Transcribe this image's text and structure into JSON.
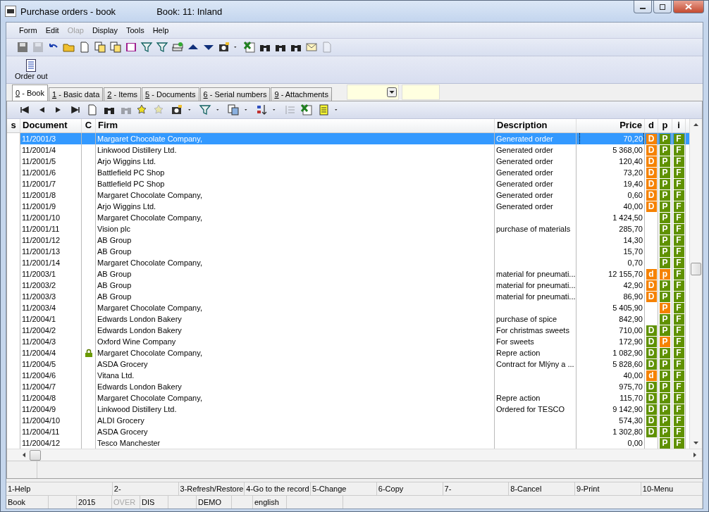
{
  "window": {
    "title": "Purchase orders - book",
    "subtitle": "Book: 11: Inland"
  },
  "menu": [
    {
      "label": "Form",
      "disabled": false
    },
    {
      "label": "Edit",
      "disabled": false
    },
    {
      "label": "Olap",
      "disabled": true
    },
    {
      "label": "Display",
      "disabled": false
    },
    {
      "label": "Tools",
      "disabled": false
    },
    {
      "label": "Help",
      "disabled": false
    }
  ],
  "action_button": {
    "label": "Order out"
  },
  "tabs": [
    {
      "key": "0",
      "label": "- Book",
      "selected": true
    },
    {
      "key": "1",
      "label": "- Basic data",
      "selected": false
    },
    {
      "key": "2",
      "label": "- Items",
      "selected": false
    },
    {
      "key": "5",
      "label": "- Documents",
      "selected": false
    },
    {
      "key": "6",
      "label": "- Serial numbers",
      "selected": false
    },
    {
      "key": "9",
      "label": "- Attachments",
      "selected": false
    }
  ],
  "table": {
    "columns": [
      "s",
      "Document",
      "C",
      "Firm",
      "Description",
      "Price",
      "d",
      "p",
      "i"
    ],
    "rows": [
      {
        "document": "11/2001/3",
        "locked": false,
        "firm": "Margaret Chocolate Company,",
        "description": "Generated order",
        "price": "70,20",
        "d": {
          "text": "D",
          "color": "#f58200"
        },
        "p": {
          "text": "P",
          "color": "#5f9100"
        },
        "i": {
          "text": "F",
          "color": "#5f9100"
        },
        "selected": true
      },
      {
        "document": "11/2001/4",
        "locked": false,
        "firm": "Linkwood Distillery Ltd.",
        "description": "Generated order",
        "price": "5 368,00",
        "d": {
          "text": "D",
          "color": "#f58200"
        },
        "p": {
          "text": "P",
          "color": "#5f9100"
        },
        "i": {
          "text": "F",
          "color": "#5f9100"
        },
        "selected": false
      },
      {
        "document": "11/2001/5",
        "locked": false,
        "firm": "Arjo Wiggins Ltd.",
        "description": "Generated order",
        "price": "120,40",
        "d": {
          "text": "D",
          "color": "#f58200"
        },
        "p": {
          "text": "P",
          "color": "#5f9100"
        },
        "i": {
          "text": "F",
          "color": "#5f9100"
        },
        "selected": false
      },
      {
        "document": "11/2001/6",
        "locked": false,
        "firm": "Battlefield PC Shop",
        "description": "Generated order",
        "price": "73,20",
        "d": {
          "text": "D",
          "color": "#f58200"
        },
        "p": {
          "text": "P",
          "color": "#5f9100"
        },
        "i": {
          "text": "F",
          "color": "#5f9100"
        },
        "selected": false
      },
      {
        "document": "11/2001/7",
        "locked": false,
        "firm": "Battlefield PC Shop",
        "description": "Generated order",
        "price": "19,40",
        "d": {
          "text": "D",
          "color": "#f58200"
        },
        "p": {
          "text": "P",
          "color": "#5f9100"
        },
        "i": {
          "text": "F",
          "color": "#5f9100"
        },
        "selected": false
      },
      {
        "document": "11/2001/8",
        "locked": false,
        "firm": "Margaret Chocolate Company,",
        "description": "Generated order",
        "price": "0,60",
        "d": {
          "text": "D",
          "color": "#f58200"
        },
        "p": {
          "text": "P",
          "color": "#5f9100"
        },
        "i": {
          "text": "F",
          "color": "#5f9100"
        },
        "selected": false
      },
      {
        "document": "11/2001/9",
        "locked": false,
        "firm": "Arjo Wiggins Ltd.",
        "description": "Generated order",
        "price": "40,00",
        "d": {
          "text": "D",
          "color": "#f58200"
        },
        "p": {
          "text": "P",
          "color": "#5f9100"
        },
        "i": {
          "text": "F",
          "color": "#5f9100"
        },
        "selected": false
      },
      {
        "document": "11/2001/10",
        "locked": false,
        "firm": "Margaret Chocolate Company,",
        "price": "1 424,50",
        "p": {
          "text": "P",
          "color": "#5f9100"
        },
        "i": {
          "text": "F",
          "color": "#5f9100"
        },
        "selected": false
      },
      {
        "document": "11/2001/11",
        "locked": false,
        "firm": "Vision plc",
        "description": "purchase of materials",
        "price": "285,70",
        "p": {
          "text": "P",
          "color": "#5f9100"
        },
        "i": {
          "text": "F",
          "color": "#5f9100"
        },
        "selected": false
      },
      {
        "document": "11/2001/12",
        "locked": false,
        "firm": "AB Group",
        "price": "14,30",
        "p": {
          "text": "P",
          "color": "#5f9100"
        },
        "i": {
          "text": "F",
          "color": "#5f9100"
        },
        "selected": false
      },
      {
        "document": "11/2001/13",
        "locked": false,
        "firm": "AB Group",
        "price": "15,70",
        "p": {
          "text": "P",
          "color": "#5f9100"
        },
        "i": {
          "text": "F",
          "color": "#5f9100"
        },
        "selected": false
      },
      {
        "document": "11/2001/14",
        "locked": false,
        "firm": "Margaret Chocolate Company,",
        "price": "0,70",
        "p": {
          "text": "P",
          "color": "#5f9100"
        },
        "i": {
          "text": "F",
          "color": "#5f9100"
        },
        "selected": false
      },
      {
        "document": "11/2003/1",
        "locked": false,
        "firm": "AB Group",
        "description": "material for pneumati...",
        "price": "12 155,70",
        "d": {
          "text": "d",
          "color": "#f58200"
        },
        "p": {
          "text": "p",
          "color": "#f58200"
        },
        "i": {
          "text": "F",
          "color": "#5f9100"
        },
        "selected": false
      },
      {
        "document": "11/2003/2",
        "locked": false,
        "firm": "AB Group",
        "description": "material for pneumati...",
        "price": "42,90",
        "d": {
          "text": "D",
          "color": "#f58200"
        },
        "p": {
          "text": "P",
          "color": "#5f9100"
        },
        "i": {
          "text": "F",
          "color": "#5f9100"
        },
        "selected": false
      },
      {
        "document": "11/2003/3",
        "locked": false,
        "firm": "AB Group",
        "description": "material for pneumati...",
        "price": "86,90",
        "d": {
          "text": "D",
          "color": "#f58200"
        },
        "p": {
          "text": "P",
          "color": "#5f9100"
        },
        "i": {
          "text": "F",
          "color": "#5f9100"
        },
        "selected": false
      },
      {
        "document": "11/2003/4",
        "locked": false,
        "firm": "Margaret Chocolate Company,",
        "price": "5 405,90",
        "p": {
          "text": "P",
          "color": "#f58200"
        },
        "i": {
          "text": "F",
          "color": "#5f9100"
        },
        "selected": false
      },
      {
        "document": "11/2004/1",
        "locked": false,
        "firm": "Edwards London Bakery",
        "description": "purchase of spice",
        "price": "842,90",
        "p": {
          "text": "P",
          "color": "#5f9100"
        },
        "i": {
          "text": "F",
          "color": "#5f9100"
        },
        "selected": false
      },
      {
        "document": "11/2004/2",
        "locked": false,
        "firm": "Edwards London Bakery",
        "description": "For christmas sweets",
        "price": "710,00",
        "d": {
          "text": "D",
          "color": "#5f9100"
        },
        "p": {
          "text": "P",
          "color": "#5f9100"
        },
        "i": {
          "text": "F",
          "color": "#5f9100"
        },
        "selected": false
      },
      {
        "document": "11/2004/3",
        "locked": false,
        "firm": "Oxford Wine Company",
        "description": "For sweets",
        "price": "172,90",
        "d": {
          "text": "D",
          "color": "#5f9100"
        },
        "p": {
          "text": "P",
          "color": "#f58200"
        },
        "i": {
          "text": "F",
          "color": "#5f9100"
        },
        "selected": false
      },
      {
        "document": "11/2004/4",
        "locked": true,
        "firm": "Margaret Chocolate Company,",
        "description": "Repre action",
        "price": "1 082,90",
        "d": {
          "text": "D",
          "color": "#5f9100"
        },
        "p": {
          "text": "P",
          "color": "#5f9100"
        },
        "i": {
          "text": "F",
          "color": "#5f9100"
        },
        "selected": false
      },
      {
        "document": "11/2004/5",
        "locked": false,
        "firm": "ASDA Grocery",
        "description": "Contract for Mlýny a ...",
        "price": "5 828,60",
        "d": {
          "text": "D",
          "color": "#5f9100"
        },
        "p": {
          "text": "P",
          "color": "#5f9100"
        },
        "i": {
          "text": "F",
          "color": "#5f9100"
        },
        "selected": false
      },
      {
        "document": "11/2004/6",
        "locked": false,
        "firm": "Vitana Ltd.",
        "price": "40,00",
        "d": {
          "text": "d",
          "color": "#f58200"
        },
        "p": {
          "text": "P",
          "color": "#5f9100"
        },
        "i": {
          "text": "F",
          "color": "#5f9100"
        },
        "selected": false
      },
      {
        "document": "11/2004/7",
        "locked": false,
        "firm": "Edwards London Bakery",
        "price": "975,70",
        "d": {
          "text": "D",
          "color": "#5f9100"
        },
        "p": {
          "text": "P",
          "color": "#5f9100"
        },
        "i": {
          "text": "F",
          "color": "#5f9100"
        },
        "selected": false
      },
      {
        "document": "11/2004/8",
        "locked": false,
        "firm": "Margaret Chocolate Company,",
        "description": "Repre action",
        "price": "115,70",
        "d": {
          "text": "D",
          "color": "#5f9100"
        },
        "p": {
          "text": "P",
          "color": "#5f9100"
        },
        "i": {
          "text": "F",
          "color": "#5f9100"
        },
        "selected": false
      },
      {
        "document": "11/2004/9",
        "locked": false,
        "firm": "Linkwood Distillery Ltd.",
        "description": "Ordered for TESCO",
        "price": "9 142,90",
        "d": {
          "text": "D",
          "color": "#5f9100"
        },
        "p": {
          "text": "P",
          "color": "#5f9100"
        },
        "i": {
          "text": "F",
          "color": "#5f9100"
        },
        "selected": false
      },
      {
        "document": "11/2004/10",
        "locked": false,
        "firm": "ALDI Grocery",
        "price": "574,30",
        "d": {
          "text": "D",
          "color": "#5f9100"
        },
        "p": {
          "text": "P",
          "color": "#5f9100"
        },
        "i": {
          "text": "F",
          "color": "#5f9100"
        },
        "selected": false
      },
      {
        "document": "11/2004/11",
        "locked": false,
        "firm": "ASDA Grocery",
        "price": "1 302,80",
        "d": {
          "text": "D",
          "color": "#5f9100"
        },
        "p": {
          "text": "P",
          "color": "#5f9100"
        },
        "i": {
          "text": "F",
          "color": "#5f9100"
        },
        "selected": false
      },
      {
        "document": "11/2004/12",
        "locked": false,
        "firm": "Tesco Manchester",
        "price": "0,00",
        "p": {
          "text": "P",
          "color": "#5f9100"
        },
        "i": {
          "text": "F",
          "color": "#5f9100"
        },
        "selected": false
      }
    ]
  },
  "function_keys": [
    "1-Help",
    "2-",
    "3-Refresh/Restore",
    "4-Go to the record",
    "5-Change",
    "6-Copy",
    "7-",
    "8-Cancel",
    "9-Print",
    "10-Menu"
  ],
  "status_bar": [
    {
      "text": "Book",
      "disabled": false
    },
    {
      "text": "2015",
      "disabled": false
    },
    {
      "text": "OVER",
      "disabled": true
    },
    {
      "text": "DIS",
      "disabled": false
    },
    {
      "text": "DEMO",
      "disabled": false
    },
    {
      "text": "english",
      "disabled": false
    }
  ]
}
